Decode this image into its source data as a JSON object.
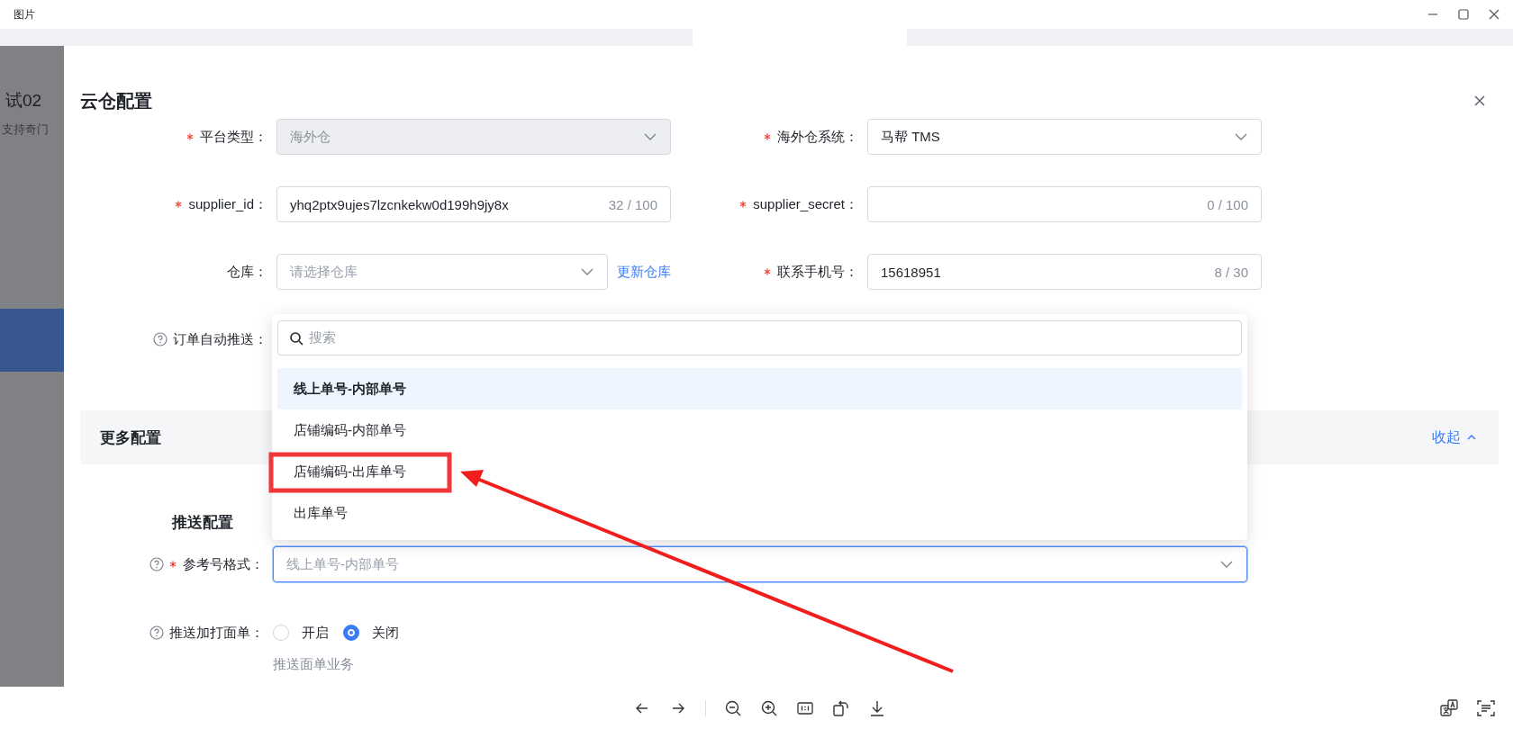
{
  "viewer": {
    "title": "图片"
  },
  "backdrop": {
    "title_fragment": "试02",
    "text_fragment": "支持奇门"
  },
  "drawer": {
    "title": "云仓配置",
    "fields": [
      {
        "label": "平台类型：",
        "required": true,
        "kind": "select",
        "value": "海外仓",
        "disabled": true
      },
      {
        "label": "海外仓系统：",
        "required": true,
        "kind": "select",
        "value": "马帮 TMS",
        "disabled": false
      },
      {
        "label": "supplier_id：",
        "required": true,
        "kind": "text",
        "value": "yhq2ptx9ujes7lzcnkekw0d199h9jy8x",
        "counter": "32 / 100"
      },
      {
        "label": "supplier_secret：",
        "required": true,
        "kind": "text",
        "counter": "0 / 100"
      },
      {
        "label": "仓库：",
        "required": false,
        "kind": "select",
        "placeholder": "请选择仓库",
        "disabled": false,
        "link": "更新仓库"
      },
      {
        "label": "联系手机号：",
        "required": true,
        "kind": "text",
        "value": "15618951",
        "counter": "8 / 30"
      }
    ],
    "auto_push": {
      "label": "订单自动推送：",
      "help": true
    },
    "more_config": {
      "title": "更多配置",
      "toggle": "收起",
      "expanded": true
    },
    "push_config": {
      "title": "推送配置",
      "reference_format": {
        "label": "参考号格式：",
        "required": true,
        "help": true,
        "placeholder": "线上单号-内部单号",
        "focused": true
      },
      "print_waybill": {
        "label": "推送加打面单：",
        "help": true,
        "options": [
          {
            "label": "开启",
            "selected": false
          },
          {
            "label": "关闭",
            "selected": true
          }
        ],
        "hint": "推送面单业务"
      }
    },
    "dropdown": {
      "search_placeholder": "搜索",
      "options": [
        {
          "label": "线上单号-内部单号",
          "selected": true
        },
        {
          "label": "店铺编码-内部单号",
          "selected": false
        },
        {
          "label": "店铺编码-出库单号",
          "selected": false
        },
        {
          "label": "出库单号",
          "selected": false
        }
      ]
    }
  }
}
